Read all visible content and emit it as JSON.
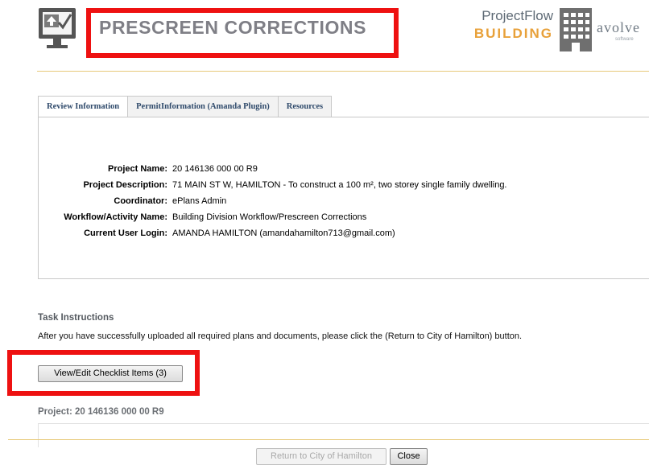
{
  "header": {
    "title": "PRESCREEN CORRECTIONS",
    "logo": {
      "line1": "ProjectFlow",
      "line2": "BUILDING",
      "vendor": "avolve",
      "vendor_sub": "software"
    },
    "colors": {
      "title": "#7f7f86",
      "brand_orange": "#e8a13a",
      "rule": "#e7c97a"
    }
  },
  "tabs": [
    {
      "label": "Review Information",
      "active": true
    },
    {
      "label": "PermitInformation (Amanda Plugin)",
      "active": false
    },
    {
      "label": "Resources",
      "active": false
    }
  ],
  "review": {
    "fields": [
      {
        "label": "Project Name:",
        "value": "20 146136 000 00 R9"
      },
      {
        "label": "Project Description:",
        "value": "71 MAIN ST W, HAMILTON - To construct a 100 m², two storey single family dwelling."
      },
      {
        "label": "Coordinator:",
        "value": "ePlans Admin"
      },
      {
        "label": "Workflow/Activity Name:",
        "value": "Building Division Workflow/Prescreen Corrections"
      },
      {
        "label": "Current User Login:",
        "value": "AMANDA HAMILTON (amandahamilton713@gmail.com)"
      }
    ]
  },
  "task": {
    "heading": "Task Instructions",
    "text": "After you have successfully uploaded all required plans and documents, please click the (Return to City of Hamilton) button.",
    "checklist_button": "View/Edit Checklist Items (3)"
  },
  "project": {
    "heading": "Project: 20 146136 000 00 R9"
  },
  "footer": {
    "return_button": "Return to City of Hamilton",
    "close_button": "Close"
  }
}
